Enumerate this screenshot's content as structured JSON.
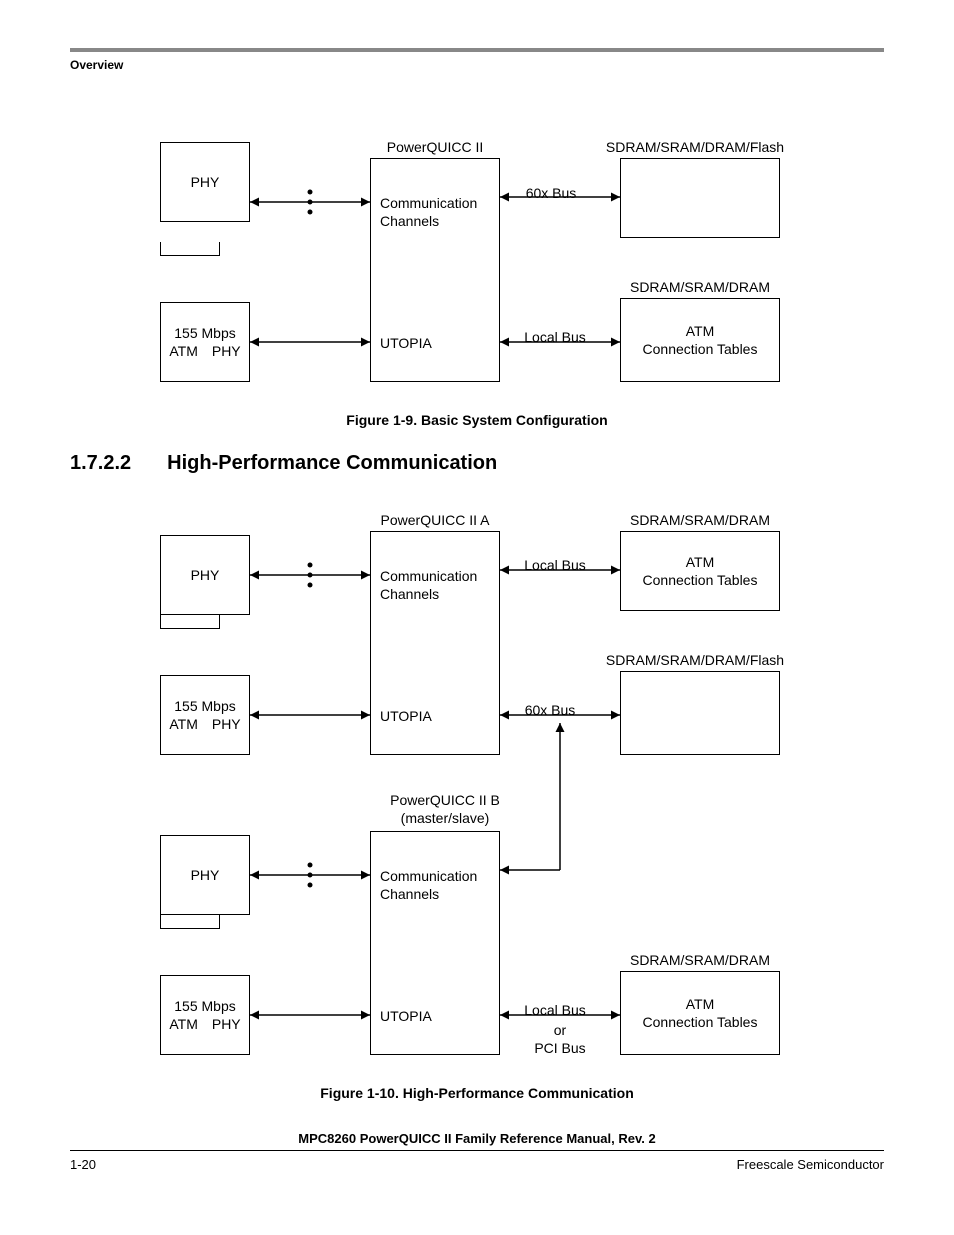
{
  "header": {
    "section_tag": "Overview"
  },
  "fig9": {
    "caption": "Figure 1-9. Basic System Configuration",
    "phy": "PHY",
    "atm_phy_line1": "155 Mbps",
    "atm_phy_line2a": "ATM",
    "atm_phy_line2b": "PHY",
    "pq_label": "PowerQUICC II",
    "comm_ch_line1": "Communication",
    "comm_ch_line2": "Channels",
    "utopia": "UTOPIA",
    "mem_top_label": "SDRAM/SRAM/DRAM/Flash",
    "mem_bot_label": "SDRAM/SRAM/DRAM",
    "atm_ct_line1": "ATM",
    "atm_ct_line2": "Connection Tables",
    "bus60x": "60x Bus",
    "localbus": "Local Bus"
  },
  "heading": {
    "num": "1.7.2.2",
    "title": "High-Performance Communication"
  },
  "fig10": {
    "caption": "Figure 1-10. High-Performance Communication",
    "phy": "PHY",
    "atm_phy_line1": "155 Mbps",
    "atm_phy_line2a": "ATM",
    "atm_phy_line2b": "PHY",
    "pq_a_label": "PowerQUICC II A",
    "pq_b_label_line1": "PowerQUICC II B",
    "pq_b_label_line2": "(master/slave)",
    "comm_ch_line1": "Communication",
    "comm_ch_line2": "Channels",
    "utopia": "UTOPIA",
    "mem_top_label": "SDRAM/SRAM/DRAM",
    "mem_mid_label": "SDRAM/SRAM/DRAM/Flash",
    "mem_bot_label": "SDRAM/SRAM/DRAM",
    "atm_ct_line1": "ATM",
    "atm_ct_line2": "Connection Tables",
    "bus60x": "60x Bus",
    "localbus": "Local Bus",
    "or": "or",
    "pcibus": "PCI Bus"
  },
  "footer": {
    "doc_title": "MPC8260 PowerQUICC II Family Reference Manual, Rev. 2",
    "page_num": "1-20",
    "company": "Freescale Semiconductor"
  }
}
